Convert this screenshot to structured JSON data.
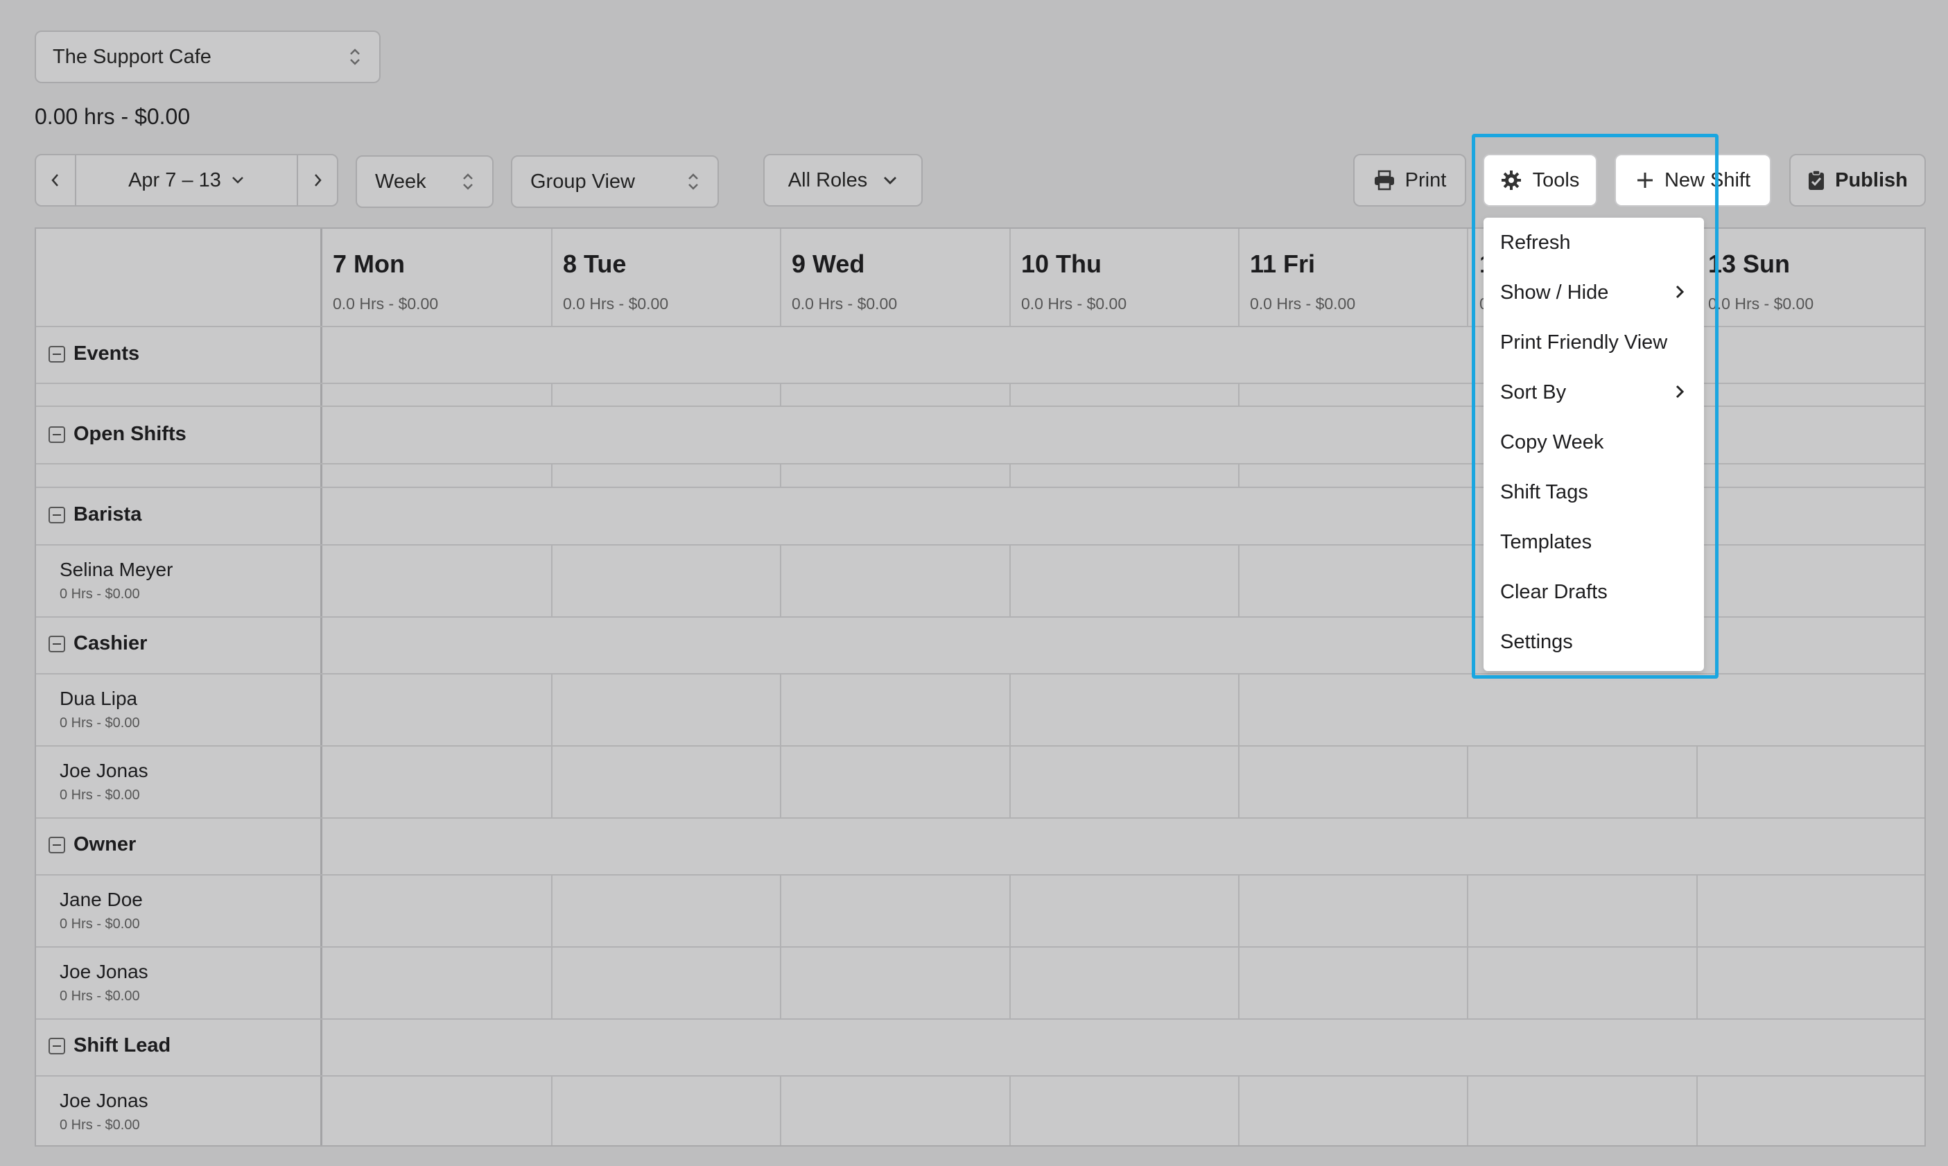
{
  "location_select": {
    "value": "The Support Cafe"
  },
  "summary": "0.00 hrs - $0.00",
  "toolbar": {
    "date_range": "Apr 7 – 13",
    "view_period": "Week",
    "view_mode": "Group View",
    "roles_filter": "All Roles",
    "print_label": "Print",
    "tools_label": "Tools",
    "new_shift_label": "New Shift",
    "publish_label": "Publish"
  },
  "days": [
    {
      "title": "7 Mon",
      "sub": "0.0 Hrs - $0.00"
    },
    {
      "title": "8 Tue",
      "sub": "0.0 Hrs - $0.00"
    },
    {
      "title": "9 Wed",
      "sub": "0.0 Hrs - $0.00"
    },
    {
      "title": "10 Thu",
      "sub": "0.0 Hrs - $0.00"
    },
    {
      "title": "11 Fri",
      "sub": "0.0 Hrs - $0.00"
    },
    {
      "title": "1",
      "sub": "0"
    },
    {
      "title": "13 Sun",
      "sub": "0.0 Hrs - $0.00"
    }
  ],
  "groups": {
    "events": "Events",
    "open_shifts": "Open Shifts",
    "barista": "Barista",
    "cashier": "Cashier",
    "owner": "Owner",
    "shift_lead": "Shift Lead"
  },
  "employees": [
    {
      "name": "Selina Meyer",
      "sub": "0 Hrs - $0.00"
    },
    {
      "name": "Dua Lipa",
      "sub": "0 Hrs - $0.00"
    },
    {
      "name": "Joe Jonas",
      "sub": "0 Hrs - $0.00"
    },
    {
      "name": "Jane Doe",
      "sub": "0 Hrs - $0.00"
    },
    {
      "name": "Joe Jonas",
      "sub": "0 Hrs - $0.00"
    },
    {
      "name": "Joe Jonas",
      "sub": "0 Hrs - $0.00"
    }
  ],
  "tools_menu": {
    "items": [
      "Refresh",
      "Show / Hide",
      "Print Friendly View",
      "Sort By",
      "Copy Week",
      "Shift Tags",
      "Templates",
      "Clear Drafts",
      "Settings"
    ]
  },
  "icons": {
    "prev": "chevron-left-icon",
    "next": "chevron-right-icon",
    "print": "printer-icon",
    "tools": "gear-icon",
    "new_shift": "plus-icon",
    "publish": "clipboard-check-icon"
  },
  "colors": {
    "highlight": "#1aa6e0",
    "menu_bg": "#ffffff",
    "page_bg": "#bebebf"
  }
}
